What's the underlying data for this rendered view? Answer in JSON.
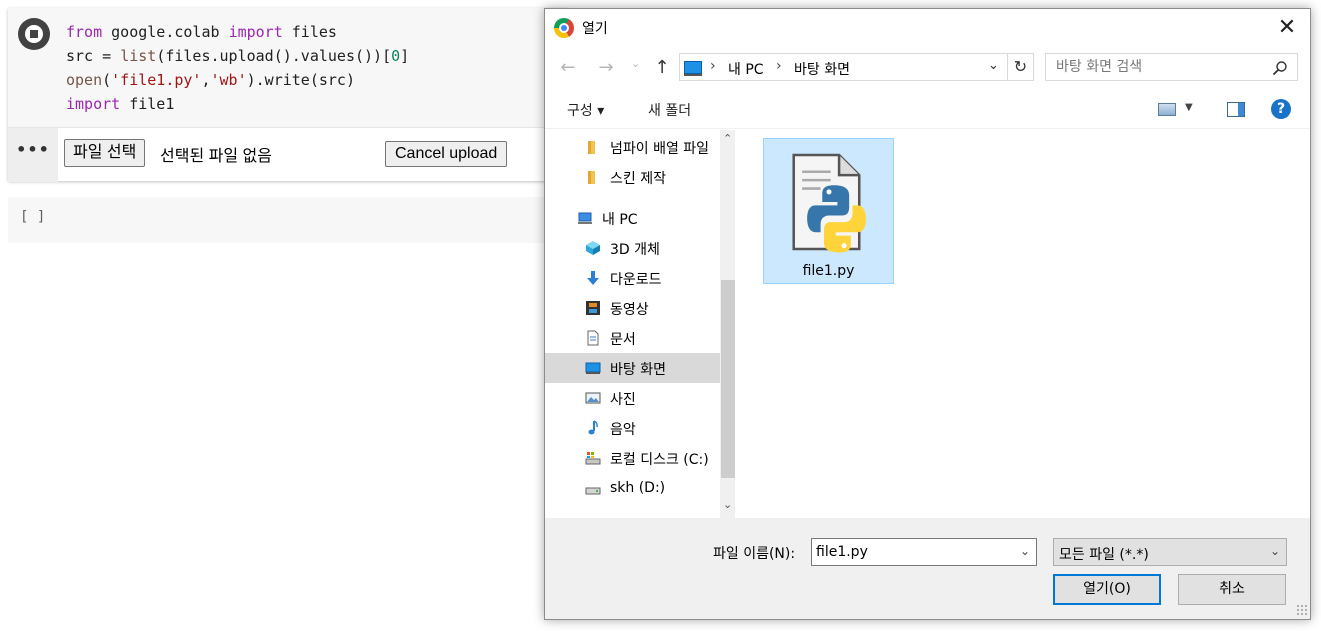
{
  "colab": {
    "code_lines": [
      [
        {
          "t": "from",
          "c": "kw"
        },
        {
          "t": " google.colab ",
          "c": ""
        },
        {
          "t": "import",
          "c": "kw"
        },
        {
          "t": " files",
          "c": ""
        }
      ],
      [
        {
          "t": "src = ",
          "c": ""
        },
        {
          "t": "list",
          "c": "fn"
        },
        {
          "t": "(files.upload().values())[",
          "c": ""
        },
        {
          "t": "0",
          "c": "num"
        },
        {
          "t": "]",
          "c": ""
        }
      ],
      [
        {
          "t": "open",
          "c": "fn"
        },
        {
          "t": "(",
          "c": ""
        },
        {
          "t": "'file1.py'",
          "c": "str"
        },
        {
          "t": ",",
          "c": ""
        },
        {
          "t": "'wb'",
          "c": "str"
        },
        {
          "t": ").write(src)",
          "c": ""
        }
      ],
      [
        {
          "t": "import",
          "c": "kw"
        },
        {
          "t": " file1",
          "c": ""
        }
      ]
    ],
    "more_label": "•••",
    "choose_file_label": "파일 선택",
    "no_file_text": "선택된 파일 없음",
    "cancel_upload_label": "Cancel upload",
    "empty_cell_bracket": "[ ]"
  },
  "dialog": {
    "title": "열기",
    "close_glyph": "✕",
    "nav": {
      "back": "←",
      "forward": "→",
      "recent": "⌄",
      "up": "↑",
      "path": [
        "내 PC",
        "바탕 화면"
      ],
      "separator": "›",
      "dropdown": "⌄",
      "refresh": "↻"
    },
    "search_placeholder": "바탕 화면 검색",
    "toolbar": {
      "organize": "구성 ▾",
      "new_folder": "새 폴더",
      "view_drop": "▼",
      "help": "?"
    },
    "nav_items": [
      {
        "label": "넘파이 배열 파일",
        "icon": "folder-icon",
        "indent": 2
      },
      {
        "label": "스킨 제작",
        "icon": "folder-icon",
        "indent": 2
      },
      {
        "label": "내 PC",
        "icon": "computer-icon",
        "indent": 1
      },
      {
        "label": "3D 개체",
        "icon": "cube-icon",
        "indent": 2
      },
      {
        "label": "다운로드",
        "icon": "download-icon",
        "indent": 2
      },
      {
        "label": "동영상",
        "icon": "video-icon",
        "indent": 2
      },
      {
        "label": "문서",
        "icon": "document-icon",
        "indent": 2
      },
      {
        "label": "바탕 화면",
        "icon": "desktop-icon",
        "indent": 2,
        "selected": true
      },
      {
        "label": "사진",
        "icon": "picture-icon",
        "indent": 2
      },
      {
        "label": "음악",
        "icon": "music-icon",
        "indent": 2
      },
      {
        "label": "로컬 디스크 (C:)",
        "icon": "local-disk-icon",
        "indent": 2
      },
      {
        "label": "skh (D:)",
        "icon": "drive-icon",
        "indent": 2
      }
    ],
    "scroll_up": "⌃",
    "scroll_down": "⌄",
    "files": [
      {
        "name": "file1.py",
        "icon": "python-file-icon",
        "selected": true
      }
    ],
    "file_name_label": "파일 이름(N):",
    "file_name_value": "file1.py",
    "file_type_value": "모든 파일 (*.*)",
    "combo_drop": "⌄",
    "open_label": "열기(O)",
    "cancel_label": "취소"
  }
}
